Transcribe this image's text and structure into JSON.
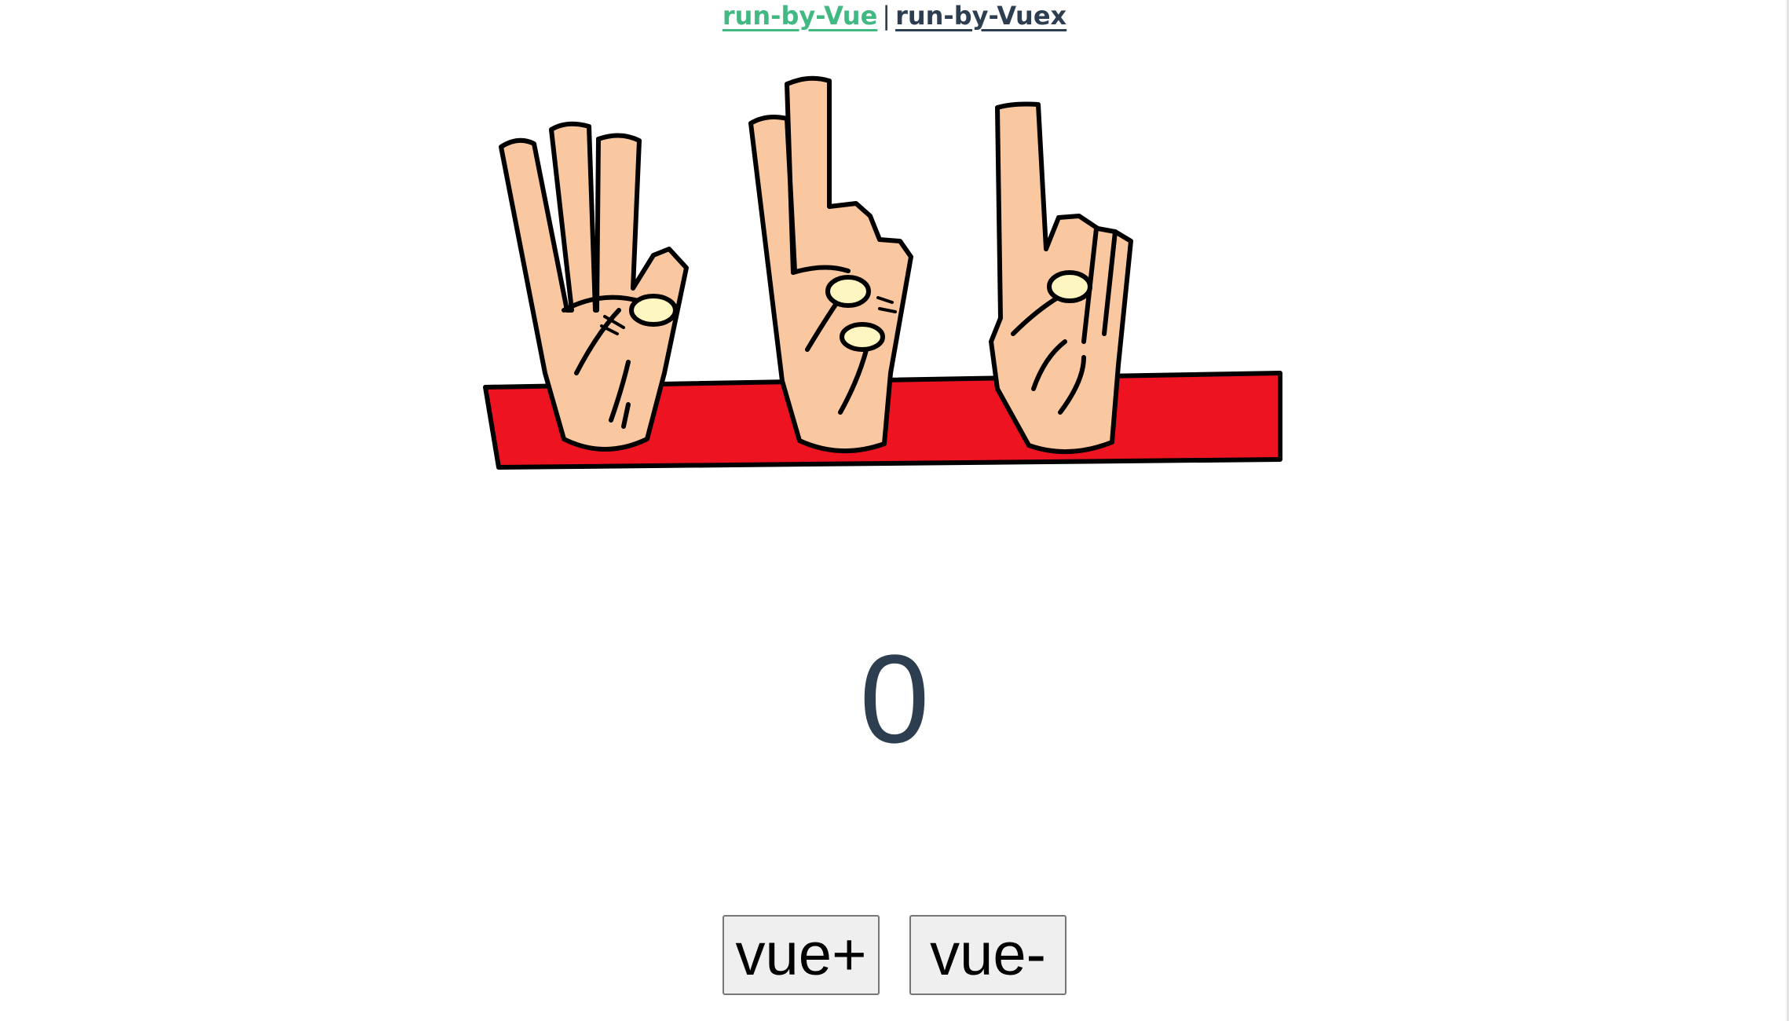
{
  "nav": {
    "link_vue": "run-by-Vue",
    "separator": "|",
    "link_vuex": "run-by-Vuex"
  },
  "logo": {
    "icon": "three-hands-counting-icon",
    "colors": {
      "skin": "#FAC8A0",
      "band": "#EE1320",
      "nail": "#FDF6C0",
      "outline": "#000000"
    }
  },
  "counter": {
    "value": "0"
  },
  "buttons": {
    "increment_label": "vue+",
    "decrement_label": "vue-"
  },
  "colors": {
    "active_link": "#42b983",
    "text": "#2c3e50"
  }
}
